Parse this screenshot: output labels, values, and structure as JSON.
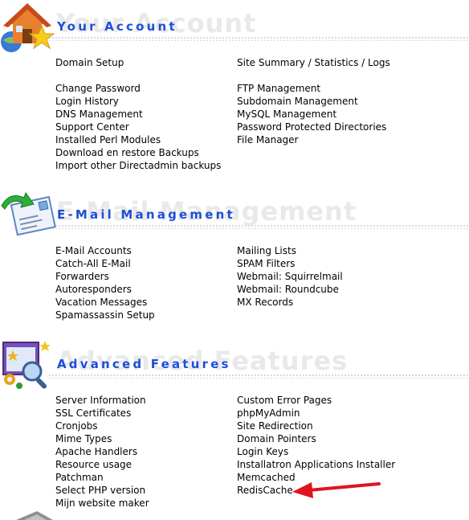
{
  "sections": [
    {
      "title": "Your Account",
      "ghost": "Your Account",
      "icon": "house-globe-star-icon",
      "left": [
        [
          "Domain Setup"
        ],
        [
          "Change Password",
          "Login History",
          "DNS Management",
          "Support Center",
          "Installed Perl Modules",
          "Download en restore Backups",
          "Import other Directadmin backups"
        ]
      ],
      "right": [
        [
          "Site Summary / Statistics / Logs"
        ],
        [
          "FTP Management",
          "Subdomain Management",
          "MySQL Management",
          "Password Protected Directories",
          "File Manager"
        ]
      ]
    },
    {
      "title": "E-Mail Management",
      "ghost": "E-Mail Management",
      "icon": "envelope-arrow-icon",
      "left": [
        [
          "E-Mail Accounts",
          "Catch-All E-Mail",
          "Forwarders",
          "Autoresponders",
          "Vacation Messages",
          "Spamassassin Setup"
        ]
      ],
      "right": [
        [
          "Mailing Lists",
          "SPAM Filters",
          "Webmail: Squirrelmail",
          "Webmail: Roundcube",
          "MX Records"
        ]
      ]
    },
    {
      "title": "Advanced Features",
      "ghost": "Advanced Features",
      "icon": "window-magnifier-icon",
      "left": [
        [
          "Server Information",
          "SSL Certificates",
          "Cronjobs",
          "Mime Types",
          "Apache Handlers",
          "Resource usage",
          "Patchman",
          "Select PHP version",
          "Mijn website maker"
        ]
      ],
      "right": [
        [
          "Custom Error Pages",
          "phpMyAdmin",
          "Site Redirection",
          "Domain Pointers",
          "Login Keys",
          "Installatron Applications Installer",
          "Memcached",
          "RedisCache"
        ]
      ]
    }
  ],
  "colors": {
    "title": "#1d4ed8",
    "ghost": "#e9e9e9",
    "arrow": "#e0141e",
    "link": "#000000"
  }
}
